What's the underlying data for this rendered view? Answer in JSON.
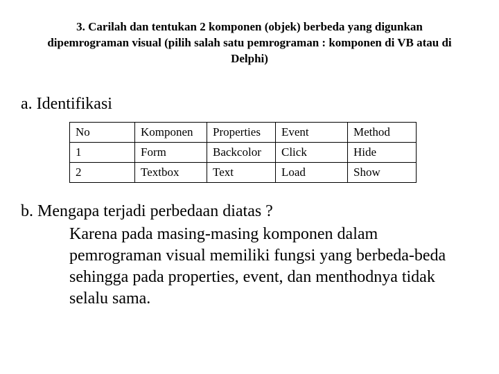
{
  "heading": "3. Carilah dan tentukan 2 komponen (objek) berbeda yang digunkan dipemrograman visual (pilih salah satu pemrograman : komponen di VB atau di Delphi)",
  "section_a_label": "a.  Identifikasi",
  "table": {
    "headers": {
      "no": "No",
      "komponen": "Komponen",
      "properties": "Properties",
      "event": "Event",
      "method": "Method"
    },
    "rows": [
      {
        "no": "1",
        "komponen": "Form",
        "properties": "Backcolor",
        "event": "Click",
        "method": "Hide"
      },
      {
        "no": "2",
        "komponen": "Textbox",
        "properties": "Text",
        "event": "Load",
        "method": "Show"
      }
    ]
  },
  "section_b_question": "b. Mengapa terjadi perbedaan diatas ?",
  "section_b_answer": "Karena pada masing-masing komponen dalam pemrograman visual memiliki fungsi yang  berbeda-beda sehingga pada properties, event, dan menthodnya tidak selalu sama."
}
